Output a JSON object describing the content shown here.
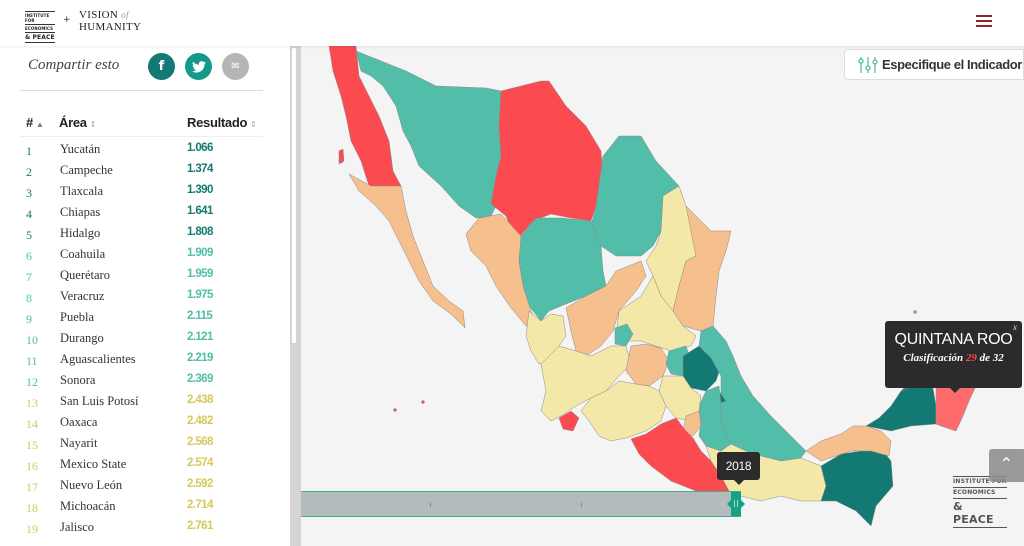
{
  "header": {
    "logo_iep": [
      "INSTITUTE FOR",
      "ECONOMICS",
      "& PEACE"
    ],
    "logo_plus": "+",
    "logo_voh_line1": "VISION",
    "logo_voh_of": "of",
    "logo_voh_line2": "HUMANITY",
    "menu_icon": "hamburger-icon"
  },
  "sidebar": {
    "share_label": "Compartir esto",
    "share_buttons": [
      {
        "name": "facebook",
        "glyph": "f"
      },
      {
        "name": "twitter",
        "glyph": "🐦"
      },
      {
        "name": "email",
        "glyph": "✉"
      }
    ],
    "table": {
      "columns": [
        "#",
        "Área",
        "Resultado"
      ],
      "sort_glyph_active": "▲",
      "sort_glyph": "⇕",
      "rows": [
        {
          "rank": "1",
          "area": "Yucatán",
          "score": "1.066",
          "color": "#137a73"
        },
        {
          "rank": "2",
          "area": "Campeche",
          "score": "1.374",
          "color": "#137a73"
        },
        {
          "rank": "3",
          "area": "Tlaxcala",
          "score": "1.390",
          "color": "#137a73"
        },
        {
          "rank": "4",
          "area": "Chiapas",
          "score": "1.641",
          "color": "#137a73"
        },
        {
          "rank": "5",
          "area": "Hidalgo",
          "score": "1.808",
          "color": "#137a73"
        },
        {
          "rank": "6",
          "area": "Coahuila",
          "score": "1.909",
          "color": "#52bda9"
        },
        {
          "rank": "7",
          "area": "Querétaro",
          "score": "1.959",
          "color": "#52bda9"
        },
        {
          "rank": "8",
          "area": "Veracruz",
          "score": "1.975",
          "color": "#52bda9"
        },
        {
          "rank": "9",
          "area": "Puebla",
          "score": "2.115",
          "color": "#52bda9"
        },
        {
          "rank": "10",
          "area": "Durango",
          "score": "2.121",
          "color": "#52bda9"
        },
        {
          "rank": "11",
          "area": "Aguascalientes",
          "score": "2.219",
          "color": "#52bda9"
        },
        {
          "rank": "12",
          "area": "Sonora",
          "score": "2.369",
          "color": "#52bda9"
        },
        {
          "rank": "13",
          "area": "San Luis Potosí",
          "score": "2.438",
          "color": "#d6c95a"
        },
        {
          "rank": "14",
          "area": "Oaxaca",
          "score": "2.482",
          "color": "#d6c95a"
        },
        {
          "rank": "15",
          "area": "Nayarit",
          "score": "2.568",
          "color": "#d6c95a"
        },
        {
          "rank": "16",
          "area": "Mexico State",
          "score": "2.574",
          "color": "#d6c95a"
        },
        {
          "rank": "17",
          "area": "Nuevo León",
          "score": "2.592",
          "color": "#d6c95a"
        },
        {
          "rank": "18",
          "area": "Michoacán",
          "score": "2.714",
          "color": "#d6c95a"
        },
        {
          "rank": "19",
          "area": "Jalisco",
          "score": "2.761",
          "color": "#d6c95a"
        }
      ]
    }
  },
  "map": {
    "indicator_button": "Especifique el Indicador",
    "colors": {
      "very_high_peace": "#137a73",
      "high_peace": "#52bda9",
      "medium": "#f3e8a8",
      "low": "#f5bf8e",
      "very_low": "#fb4b51",
      "highlight": "#fd6b6b",
      "background": "#f4f4f4"
    },
    "tooltip": {
      "state": "QUINTANA ROO",
      "prefix": "Clasificación",
      "rank": "29",
      "middle": "de",
      "total": "32",
      "close": "x"
    },
    "timeline": {
      "year": "2018",
      "position": 1.0
    },
    "scroll_top_glyph": "⌃",
    "logo_bottom": [
      "INSTITUTE FOR",
      "ECONOMICS",
      "& PEACE"
    ]
  }
}
